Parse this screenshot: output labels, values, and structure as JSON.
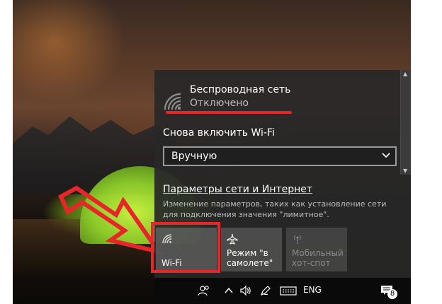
{
  "network": {
    "name": "Беспроводная сеть",
    "status": "Отключено"
  },
  "turn_on_wifi": {
    "label": "Снова включить Wi-Fi",
    "selected": "Вручную"
  },
  "settings_link": {
    "label": "Параметры сети и Интернет",
    "description": "Изменение параметров, таких как установление сети для подключения значения \"лимитное\"."
  },
  "quick_actions": [
    {
      "label": "Wi-Fi",
      "icon": "wifi-icon",
      "state": "off"
    },
    {
      "label": "Режим \"в самолете\"",
      "icon": "airplane-icon",
      "state": "off"
    },
    {
      "label": "Мобильный хот-спот",
      "icon": "hotspot-icon",
      "state": "disabled"
    }
  ],
  "taskbar": {
    "language": "ENG",
    "notification_count": "8"
  },
  "colors": {
    "highlight_red": "#e8262a",
    "panel_bg": "#282828",
    "secondary_text": "#bcbcbc"
  }
}
